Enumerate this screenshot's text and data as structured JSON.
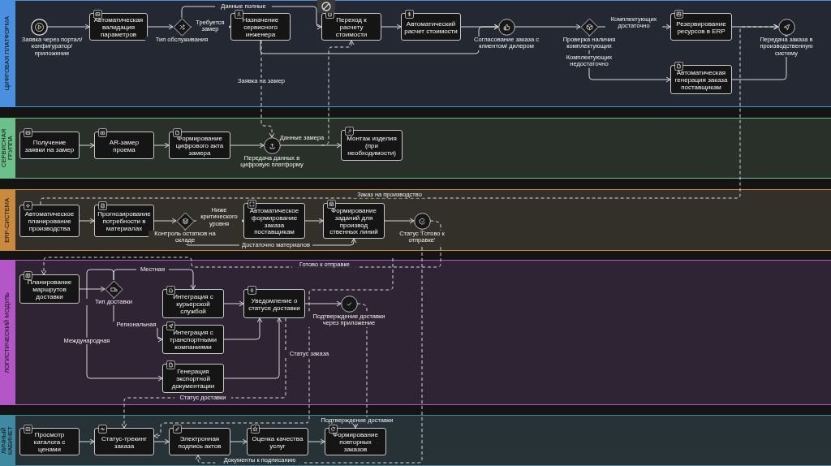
{
  "lanes": [
    {
      "label": "ЦИФРОВАЯ ПЛАТФОРМА",
      "color": "#4a8fe0",
      "nodes": [
        {
          "kind": "event",
          "label": "Заявка через портал/конфигуратор/ приложение"
        },
        {
          "kind": "task",
          "label": "Автоматическая валидация параметров"
        },
        {
          "kind": "gateway",
          "label": "Тип обслуживания"
        },
        {
          "kind": "task",
          "label": "Назначение сервисного инженера"
        },
        {
          "kind": "task",
          "label": "Переход к расчету стоимости"
        },
        {
          "kind": "task",
          "label": "Автоматический расчет стоимости"
        },
        {
          "kind": "event",
          "label": "Согласование заказа с клиентом/ дилером"
        },
        {
          "kind": "gateway",
          "label": "Проверка наличия комплектующих"
        },
        {
          "kind": "task",
          "label": "Резервирование ресурсов в ERP"
        },
        {
          "kind": "event",
          "label": "Передача заказа в производственную систему"
        },
        {
          "kind": "task",
          "label": "Автоматическая генерация заказа поставщикам"
        }
      ],
      "flow_labels": [
        "Данные полные",
        "Требуется замер",
        "Заявка на замер",
        "Комплектующих достаточно",
        "Комплектующих недостаточно"
      ]
    },
    {
      "label": "СЕРВИСНАЯ ГРУППА",
      "color": "#6cc08a",
      "nodes": [
        {
          "kind": "task",
          "label": "Получение заявки на замер"
        },
        {
          "kind": "task",
          "label": "AR-замер проема"
        },
        {
          "kind": "task",
          "label": "Формирование цифрового акта замера"
        },
        {
          "kind": "event",
          "label": "Передача данных в цифровую платформу"
        },
        {
          "kind": "task",
          "label": "Монтаж изделия (при необходимости)"
        }
      ],
      "flow_labels": [
        "Данные замера"
      ]
    },
    {
      "label": "ERP-СИСТЕМА",
      "color": "#c9893e",
      "nodes": [
        {
          "kind": "task",
          "label": "Автоматическое планирование производства"
        },
        {
          "kind": "task",
          "label": "Прогнозирование потребности в материалах"
        },
        {
          "kind": "gateway",
          "label": "Контроль остатков на складе"
        },
        {
          "kind": "task",
          "label": "Автоматическое формирование заказа поставщикам"
        },
        {
          "kind": "task",
          "label": "Формирование заданий для производ ственных линий"
        },
        {
          "kind": "event",
          "label": "Статус 'Готово к отправке'"
        }
      ],
      "flow_labels": [
        "Ниже критического уровня",
        "Достаточно материалов",
        "Заказ на производство"
      ]
    },
    {
      "label": "ЛОГИСТИЧЕСКИЙ МОДУЛЬ",
      "color": "#b455c8",
      "nodes": [
        {
          "kind": "task",
          "label": "Планирование маршрутов доставки"
        },
        {
          "kind": "gateway",
          "label": "Тип доставки"
        },
        {
          "kind": "task",
          "label": "Интеграция с курьерской службой"
        },
        {
          "kind": "task",
          "label": "Интеграция с транспортными компаниями"
        },
        {
          "kind": "task",
          "label": "Генерация экспортной документации"
        },
        {
          "kind": "task",
          "label": "Уведомление о статусе доставки"
        },
        {
          "kind": "event",
          "label": "Подтверждение доставки через приложение"
        }
      ],
      "flow_labels": [
        "Готово к отправке",
        "Местная",
        "Международная",
        "Региональная",
        "Статус заказа",
        "Статус доставки"
      ]
    },
    {
      "label": "ЛИЧНЫЙ КАБИНЕТ",
      "color": "#3f8aa0",
      "nodes": [
        {
          "kind": "task",
          "label": "Просмотр каталога с ценами"
        },
        {
          "kind": "task",
          "label": "Статус-трекинг заказа"
        },
        {
          "kind": "task",
          "label": "Электронная подпись актов"
        },
        {
          "kind": "task",
          "label": "Оценка качества услуг"
        },
        {
          "kind": "task",
          "label": "Формирование повторных заказов"
        }
      ],
      "flow_labels": [
        "Подтверждение доставки",
        "Документы к подписанию"
      ]
    }
  ]
}
